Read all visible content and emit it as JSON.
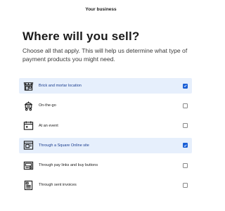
{
  "header": {
    "title": "Your business"
  },
  "main": {
    "heading": "Where will you sell?",
    "subheading": "Choose all that apply. This will help us determine what type of payment products you might need.",
    "options": [
      {
        "label": "Brick and mortar location",
        "icon": "storefront-icon",
        "checked": true
      },
      {
        "label": "On-the-go",
        "icon": "cart-icon",
        "checked": false
      },
      {
        "label": "At an event",
        "icon": "calendar-icon",
        "checked": false
      },
      {
        "label": "Through a Square Online site",
        "icon": "browser-window-icon",
        "checked": true
      },
      {
        "label": "Through pay links and buy buttons",
        "icon": "payment-link-icon",
        "checked": false
      },
      {
        "label": "Through sent invoices",
        "icon": "invoice-icon",
        "checked": false
      }
    ]
  },
  "colors": {
    "accent": "#1a5fd6",
    "selected_bg": "#e6effc"
  }
}
